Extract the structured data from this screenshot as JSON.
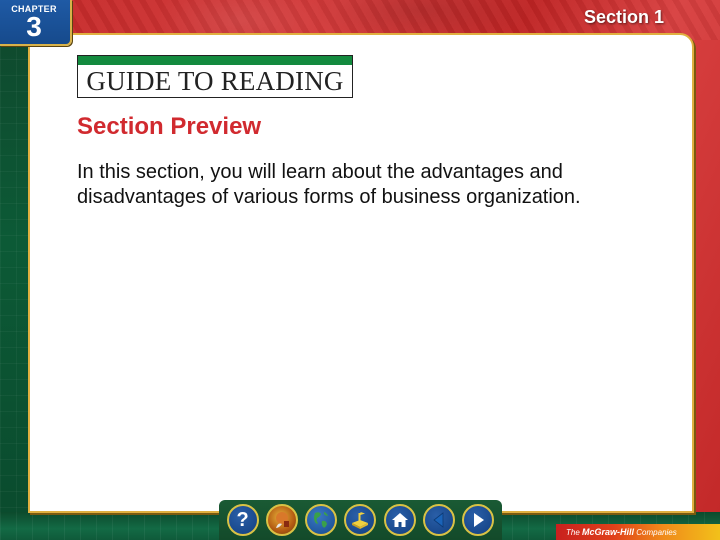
{
  "header": {
    "chapter_label": "CHAPTER",
    "chapter_number": "3",
    "section_label": "Section 1"
  },
  "banner": {
    "text": "GUIDE TO READING"
  },
  "content": {
    "title": "Section Preview",
    "body": "In this section, you will learn about the advantages and disadvantages of various forms of business organization."
  },
  "nav": {
    "buttons": [
      {
        "name": "help",
        "icon": "question-icon",
        "label": "?"
      },
      {
        "name": "reference",
        "icon": "reference-library-icon"
      },
      {
        "name": "world",
        "icon": "globe-icon"
      },
      {
        "name": "resource-manager",
        "icon": "joystick-icon"
      },
      {
        "name": "home",
        "icon": "home-icon"
      },
      {
        "name": "previous",
        "icon": "previous-arrow-icon"
      },
      {
        "name": "next",
        "icon": "next-arrow-icon"
      }
    ]
  },
  "footer": {
    "publisher_prefix": "The",
    "publisher_name": "McGraw-Hill",
    "publisher_suffix": "Companies"
  },
  "colors": {
    "title_red": "#d12a2f",
    "banner_green": "#138a3e",
    "chapter_blue": "#1f5aa5",
    "border_gold": "#e0b040"
  }
}
